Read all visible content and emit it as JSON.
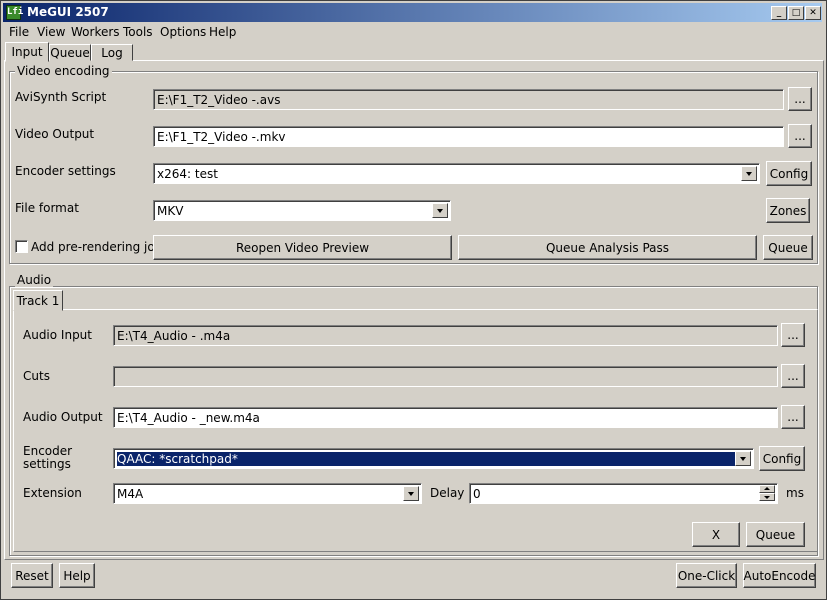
{
  "window": {
    "title": "MeGUI 2507",
    "icon": "megui-app-icon"
  },
  "menu": [
    "File",
    "View",
    "Workers",
    "Tools",
    "Options",
    "Help"
  ],
  "main_tabs": [
    "Input",
    "Queue",
    "Log"
  ],
  "video": {
    "group_label": "Video encoding",
    "avisynth_label": "AviSynth Script",
    "avisynth_value": "E:\\F1_T2_Video -.avs",
    "output_label": "Video Output",
    "output_value": "E:\\F1_T2_Video -.mkv",
    "encoder_label": "Encoder settings",
    "encoder_value": "x264: test",
    "format_label": "File format",
    "format_value": "MKV",
    "prerender_label": "Add pre-rendering job",
    "browse": "...",
    "config": "Config",
    "zones": "Zones",
    "reopen_preview": "Reopen Video Preview",
    "queue_analysis": "Queue Analysis Pass",
    "queue": "Queue"
  },
  "audio": {
    "group_label": "Audio",
    "track_tab": "Track 1",
    "input_label": "Audio Input",
    "input_value": "E:\\T4_Audio - .m4a",
    "cuts_label": "Cuts",
    "cuts_value": "",
    "output_label": "Audio Output",
    "output_value": "E:\\T4_Audio - _new.m4a",
    "encoder_label_line1": "Encoder",
    "encoder_label_line2": "settings",
    "encoder_value": "QAAC: *scratchpad*",
    "extension_label": "Extension",
    "extension_value": "M4A",
    "delay_label": "Delay",
    "delay_value": "0",
    "delay_unit": "ms",
    "browse": "...",
    "config": "Config",
    "remove": "X",
    "queue": "Queue"
  },
  "footer": {
    "reset": "Reset",
    "help": "Help",
    "oneclick": "One-Click",
    "autoencode": "AutoEncode"
  }
}
